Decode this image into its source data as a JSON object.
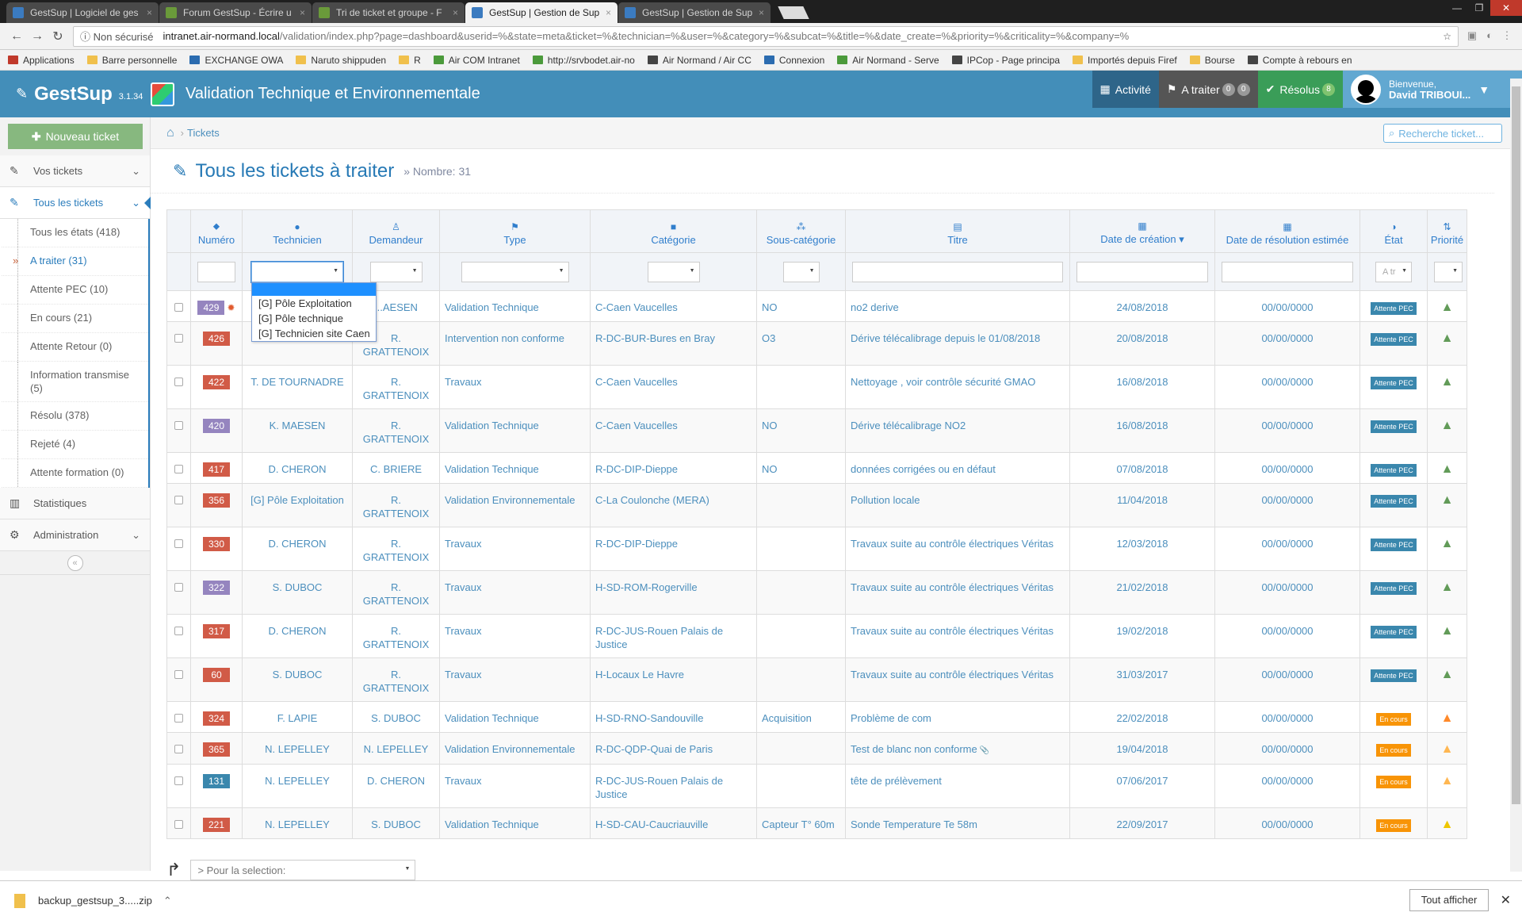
{
  "browser": {
    "tabs": [
      {
        "title": "GestSup | Logiciel de ges",
        "active": false
      },
      {
        "title": "Forum GestSup - Écrire u",
        "active": false
      },
      {
        "title": "Tri de ticket et groupe - F",
        "active": false
      },
      {
        "title": "GestSup | Gestion de Sup",
        "active": true
      },
      {
        "title": "GestSup | Gestion de Sup",
        "active": false
      }
    ],
    "security": "Non sécurisé",
    "url_host": "intranet.air-normand.local",
    "url_path": "/validation/index.php?page=dashboard&userid=%&state=meta&ticket=%&technician=%&user=%&category=%&subcat=%&title=%&date_create=%&priority=%&criticality=%&company=%",
    "bookmarks": [
      "Applications",
      "Barre personnelle",
      "EXCHANGE OWA",
      "Naruto shippuden",
      "R",
      "Air COM Intranet",
      "http://srvbodet.air-no",
      "Air Normand / Air CC",
      "Connexion",
      "Air Normand - Serve",
      "IPCop - Page principa",
      "Importés depuis Firef",
      "Bourse",
      "Compte à rebours en"
    ]
  },
  "header": {
    "brand": "GestSup",
    "version": "3.1.34",
    "title": "Validation Technique et Environnementale",
    "activity": "Activité",
    "todo": "A traiter",
    "todo_b1": "0",
    "todo_b2": "0",
    "resolved": "Résolus",
    "resolved_b": "8",
    "welcome": "Bienvenue,",
    "user": "David TRIBOUI..."
  },
  "sidebar": {
    "new_ticket": "Nouveau ticket",
    "your_tickets": "Vos tickets",
    "all_tickets": "Tous les tickets",
    "items": [
      "Tous les états (418)",
      "A traiter (31)",
      "Attente PEC (10)",
      "En cours (21)",
      "Attente Retour (0)",
      "Information transmise (5)",
      "Résolu (378)",
      "Rejeté (4)",
      "Attente formation (0)"
    ],
    "stats": "Statistiques",
    "admin": "Administration"
  },
  "breadcrumb": "Tickets",
  "search_placeholder": "Recherche ticket...",
  "page": {
    "title": "Tous les tickets à traiter",
    "count": "Nombre: 31"
  },
  "table": {
    "headers": [
      "Numéro",
      "Technicien",
      "Demandeur",
      "Type",
      "Catégorie",
      "Sous-catégorie",
      "Titre",
      "Date de création",
      "Date de résolution estimée",
      "État",
      "Priorité"
    ],
    "state_filter": "A tr",
    "rows": [
      {
        "num": "429",
        "color": "purple",
        "star": true,
        "tech": "",
        "req": "...AESEN",
        "type": "Validation Technique",
        "cat": "C-Caen Vaucelles",
        "sub": "NO",
        "title": "no2 derive",
        "created": "24/08/2018",
        "est": "00/00/0000",
        "state": "Attente PEC",
        "sc": "pec",
        "pri": "g"
      },
      {
        "num": "426",
        "color": "red",
        "tech": "",
        "req": "R. GRATTENOIX",
        "type": "Intervention non conforme",
        "cat": "R-DC-BUR-Bures en Bray",
        "sub": "O3",
        "title": "Dérive télécalibrage depuis le 01/08/2018",
        "created": "20/08/2018",
        "est": "00/00/0000",
        "state": "Attente PEC",
        "sc": "pec",
        "pri": "g"
      },
      {
        "num": "422",
        "color": "red",
        "tech": "T. DE TOURNADRE",
        "req": "R. GRATTENOIX",
        "type": "Travaux",
        "cat": "C-Caen Vaucelles",
        "sub": "",
        "title": "Nettoyage , voir contrôle sécurité GMAO",
        "created": "16/08/2018",
        "est": "00/00/0000",
        "state": "Attente PEC",
        "sc": "pec",
        "pri": "g"
      },
      {
        "num": "420",
        "color": "purple",
        "tech": "K. MAESEN",
        "req": "R. GRATTENOIX",
        "type": "Validation Technique",
        "cat": "C-Caen Vaucelles",
        "sub": "NO",
        "title": "Dérive télécalibrage NO2",
        "created": "16/08/2018",
        "est": "00/00/0000",
        "state": "Attente PEC",
        "sc": "pec",
        "pri": "g"
      },
      {
        "num": "417",
        "color": "red",
        "tech": "D. CHERON",
        "req": "C. BRIERE",
        "type": "Validation Technique",
        "cat": "R-DC-DIP-Dieppe",
        "sub": "NO",
        "title": "données corrigées ou en défaut",
        "created": "07/08/2018",
        "est": "00/00/0000",
        "state": "Attente PEC",
        "sc": "pec",
        "pri": "g"
      },
      {
        "num": "356",
        "color": "red",
        "tech": "[G] Pôle Exploitation",
        "req": "R. GRATTENOIX",
        "type": "Validation Environnementale",
        "cat": "C-La Coulonche (MERA)",
        "sub": "",
        "title": "Pollution locale",
        "created": "11/04/2018",
        "est": "00/00/0000",
        "state": "Attente PEC",
        "sc": "pec",
        "pri": "g"
      },
      {
        "num": "330",
        "color": "red",
        "tech": "D. CHERON",
        "req": "R. GRATTENOIX",
        "type": "Travaux",
        "cat": "R-DC-DIP-Dieppe",
        "sub": "",
        "title": "Travaux suite au contrôle électriques Véritas",
        "created": "12/03/2018",
        "est": "00/00/0000",
        "state": "Attente PEC",
        "sc": "pec",
        "pri": "g"
      },
      {
        "num": "322",
        "color": "purple",
        "tech": "S. DUBOC",
        "req": "R. GRATTENOIX",
        "type": "Travaux",
        "cat": "H-SD-ROM-Rogerville",
        "sub": "",
        "title": "Travaux suite au contrôle électriques Véritas",
        "created": "21/02/2018",
        "est": "00/00/0000",
        "state": "Attente PEC",
        "sc": "pec",
        "pri": "g"
      },
      {
        "num": "317",
        "color": "red",
        "tech": "D. CHERON",
        "req": "R. GRATTENOIX",
        "type": "Travaux",
        "cat": "R-DC-JUS-Rouen Palais de Justice",
        "sub": "",
        "title": "Travaux suite au contrôle électriques Véritas",
        "created": "19/02/2018",
        "est": "00/00/0000",
        "state": "Attente PEC",
        "sc": "pec",
        "pri": "g"
      },
      {
        "num": "60",
        "color": "red",
        "tech": "S. DUBOC",
        "req": "R. GRATTENOIX",
        "type": "Travaux",
        "cat": "H-Locaux Le Havre",
        "sub": "",
        "title": "Travaux suite au contrôle électriques Véritas",
        "created": "31/03/2017",
        "est": "00/00/0000",
        "state": "Attente PEC",
        "sc": "pec",
        "pri": "g"
      },
      {
        "num": "324",
        "color": "red",
        "tech": "F. LAPIE",
        "req": "S. DUBOC",
        "type": "Validation Technique",
        "cat": "H-SD-RNO-Sandouville",
        "sub": "Acquisition",
        "title": "Problème de com",
        "created": "22/02/2018",
        "est": "00/00/0000",
        "state": "En cours",
        "sc": "cours",
        "pri": "o"
      },
      {
        "num": "365",
        "color": "red",
        "tech": "N. LEPELLEY",
        "req": "N. LEPELLEY",
        "type": "Validation Environnementale",
        "cat": "R-DC-QDP-Quai de Paris",
        "sub": "",
        "title": "Test de blanc non conforme",
        "clip": true,
        "created": "19/04/2018",
        "est": "00/00/0000",
        "state": "En cours",
        "sc": "cours",
        "pri": "y"
      },
      {
        "num": "131",
        "color": "blue",
        "tech": "N. LEPELLEY",
        "req": "D. CHERON",
        "type": "Travaux",
        "cat": "R-DC-JUS-Rouen Palais de Justice",
        "sub": "",
        "title": "tête de prélèvement",
        "created": "07/06/2017",
        "est": "00/00/0000",
        "state": "En cours",
        "sc": "cours",
        "pri": "y"
      },
      {
        "num": "221",
        "color": "red",
        "tech": "N. LEPELLEY",
        "req": "S. DUBOC",
        "type": "Validation Technique",
        "cat": "H-SD-CAU-Caucriauville",
        "sub": "Capteur T° 60m",
        "title": "Sonde Temperature Te 58m",
        "created": "22/09/2017",
        "est": "00/00/0000",
        "state": "En cours",
        "sc": "cours",
        "pri": "l"
      }
    ]
  },
  "dropdown": {
    "options": [
      "[G] Pôle Exploitation",
      "[G] Pôle technique",
      "[G] Technicien site Caen"
    ]
  },
  "bulk": "> Pour la selection:",
  "download": {
    "file": "backup_gestsup_3.....zip",
    "show_all": "Tout afficher"
  },
  "colors": {
    "header": "#438eb9",
    "accent": "#2b7dbc",
    "green": "#87b87f"
  }
}
